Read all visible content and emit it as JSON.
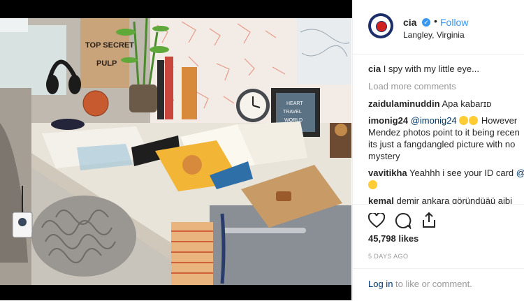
{
  "post": {
    "username": "cia",
    "follow_label": "Follow",
    "separator": "•",
    "location": "Langley, Virginia",
    "caption_user": "cia",
    "caption_text": "I spy with my little eye...",
    "load_more": "Load more comments",
    "likes": "45,798 likes",
    "time_ago": "5 DAYS AGO",
    "login_link": "Log in",
    "login_text": "to like or comment."
  },
  "photo": {
    "box_label_line1": "TOP SECRET",
    "box_label_line2": "PULP",
    "frame_text_line1": "HEART",
    "frame_text_line2": "TRAVEL",
    "frame_text_line3": "WORLD"
  },
  "comments": [
    {
      "user": "zaidulaminuddin",
      "text": "Apa kabarɪᴅ"
    },
    {
      "user": "imonig24",
      "mention": "@imonig24",
      "text_line1": "However",
      "text_line2": "Mendez photos point to it being recen",
      "text_line3": "its just a fangdangled picture with no",
      "text_line4": "mystery"
    },
    {
      "user": "vavitikha",
      "text_line1": "Yeahhh i see your ID card",
      "mention": "@"
    },
    {
      "user": "kemal",
      "text": "demir  ankara  ɑöründüäü  aibi"
    }
  ],
  "colors": {
    "accent": "#3897f0",
    "link": "#003569",
    "muted": "#999999"
  },
  "icons": [
    "verified-badge-icon",
    "heart-icon",
    "comment-icon",
    "share-icon",
    "cia-seal-avatar"
  ]
}
